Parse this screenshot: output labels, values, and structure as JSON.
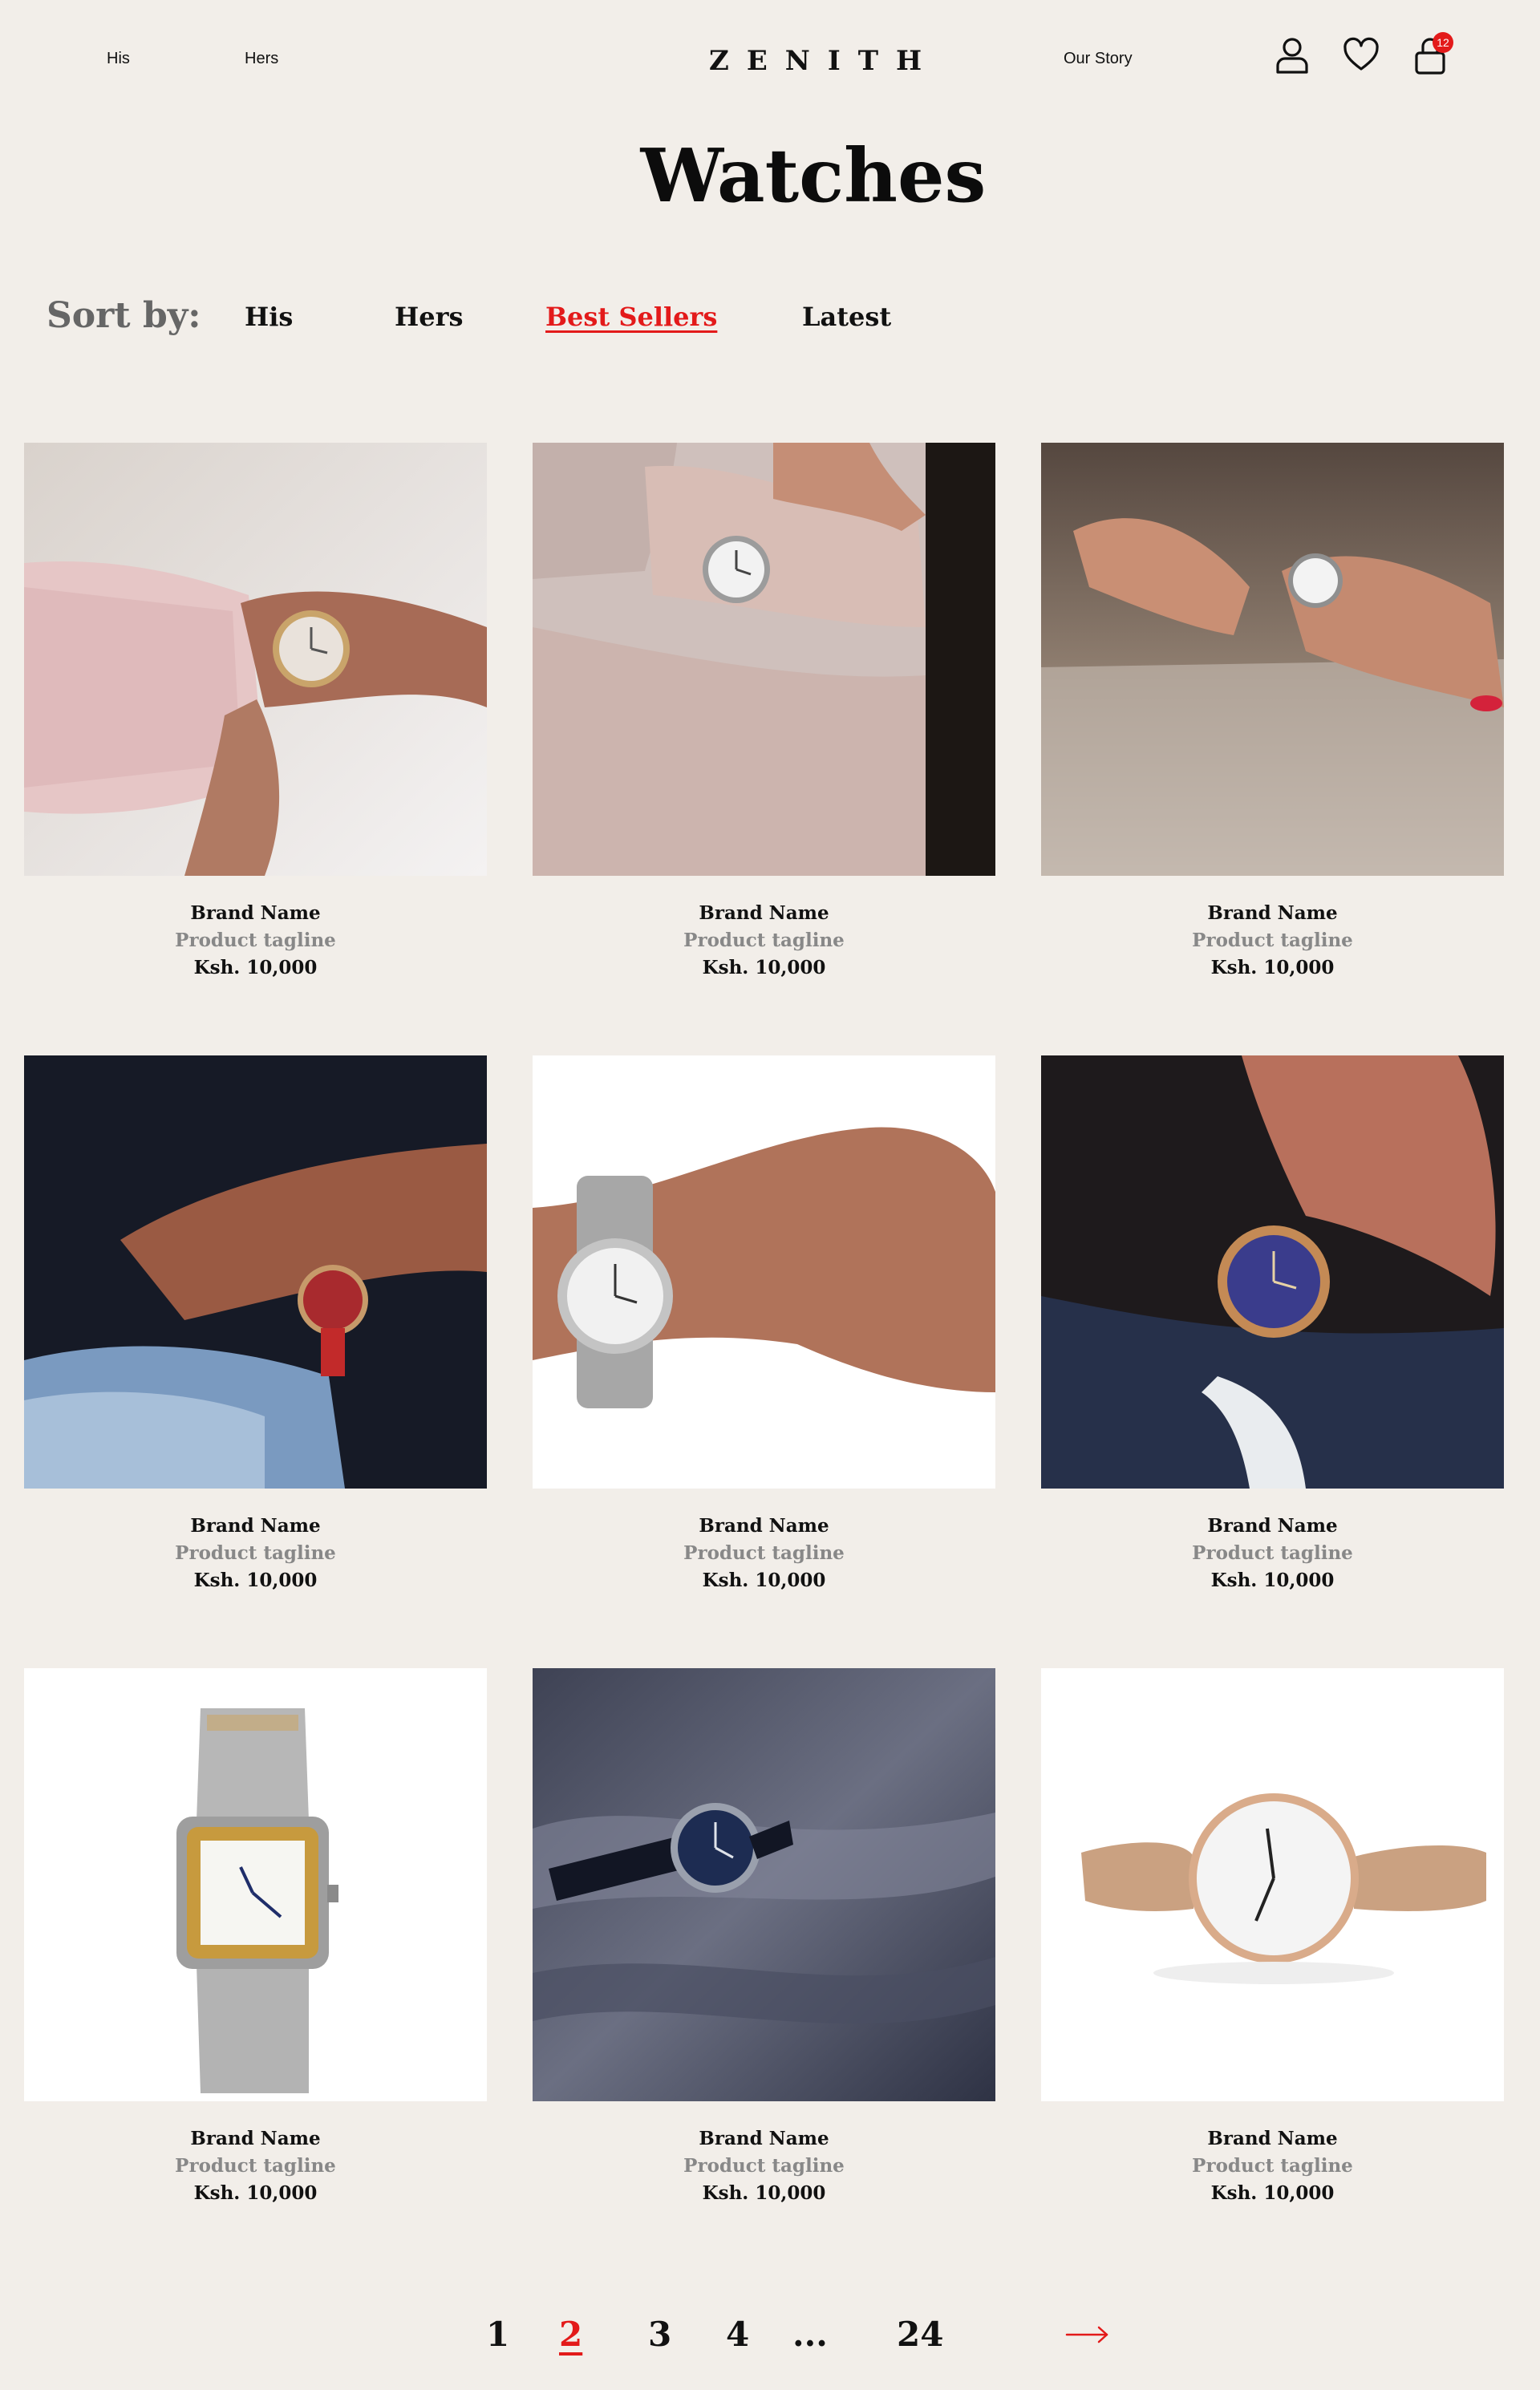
{
  "header": {
    "nav_left": [
      "His",
      "Hers"
    ],
    "logo": "ZENITH",
    "nav_right": "Our Story",
    "cart_count": "12",
    "icons": [
      "user-icon",
      "heart-icon",
      "shopping-bag-icon"
    ]
  },
  "page_title": "Watches",
  "sort": {
    "label": "Sort by:",
    "options": [
      "His",
      "Hers",
      "Best Sellers",
      "Latest"
    ],
    "active": "Best Sellers"
  },
  "products": [
    {
      "brand": "Brand Name",
      "tagline": "Product tagline",
      "price": "Ksh. 10,000",
      "image": "pink-sweater-gold-watch"
    },
    {
      "brand": "Brand Name",
      "tagline": "Product tagline",
      "price": "Ksh. 10,000",
      "image": "sweater-mesh-watch"
    },
    {
      "brand": "Brand Name",
      "tagline": "Product tagline",
      "price": "Ksh. 10,000",
      "image": "hands-on-glass-watch"
    },
    {
      "brand": "Brand Name",
      "tagline": "Product tagline",
      "price": "Ksh. 10,000",
      "image": "red-dial-watch-jeans"
    },
    {
      "brand": "Brand Name",
      "tagline": "Product tagline",
      "price": "Ksh. 10,000",
      "image": "steel-watch-wrist"
    },
    {
      "brand": "Brand Name",
      "tagline": "Product tagline",
      "price": "Ksh. 10,000",
      "image": "blue-dial-gold-watch"
    },
    {
      "brand": "Brand Name",
      "tagline": "Product tagline",
      "price": "Ksh. 10,000",
      "image": "square-two-tone-watch"
    },
    {
      "brand": "Brand Name",
      "tagline": "Product tagline",
      "price": "Ksh. 10,000",
      "image": "navy-watch-on-fabric"
    },
    {
      "brand": "Brand Name",
      "tagline": "Product tagline",
      "price": "Ksh. 10,000",
      "image": "rose-gold-mesh-watch"
    }
  ],
  "pagination": {
    "pages": [
      "1",
      "2",
      "3",
      "4",
      "...",
      "24"
    ],
    "active": "2",
    "next_icon": "arrow-right-icon"
  },
  "colors": {
    "background": "#f2eee9",
    "accent": "#e31a1a",
    "text": "#111111",
    "muted": "#888888"
  }
}
